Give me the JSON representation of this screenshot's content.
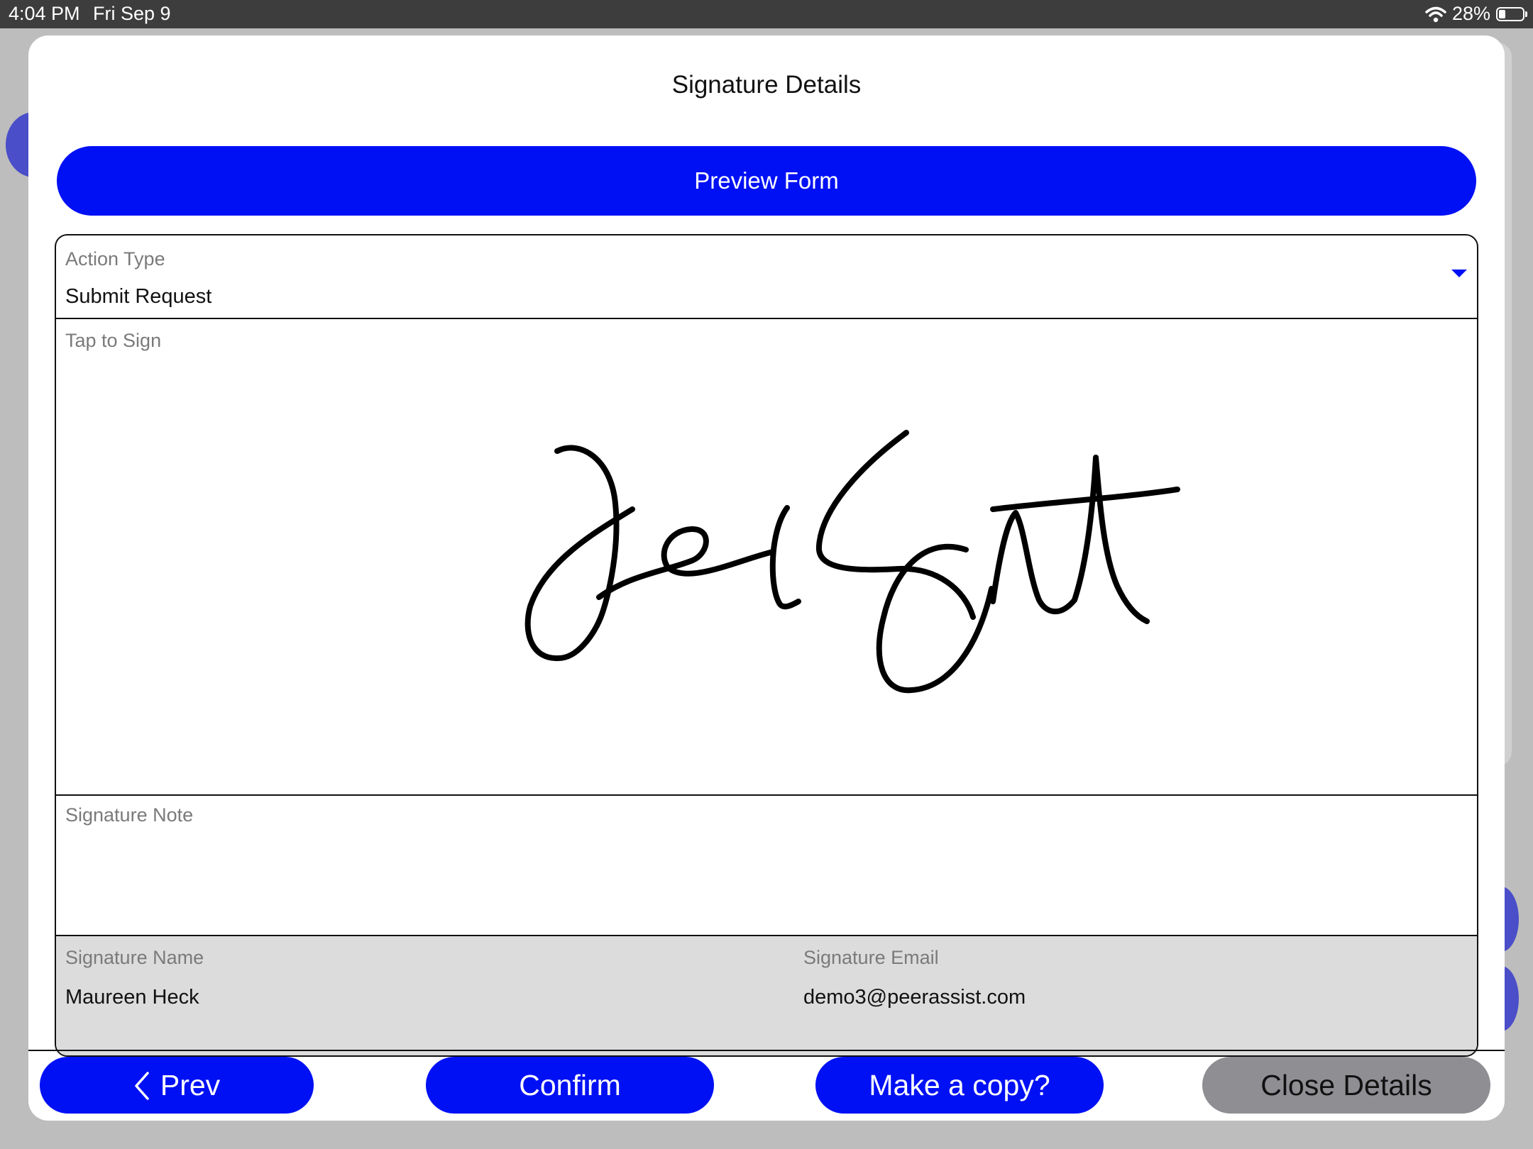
{
  "status_bar": {
    "time": "4:04 PM",
    "date": "Fri Sep 9",
    "battery_text": "28%",
    "battery_level": 0.28
  },
  "sheet": {
    "title": "Signature Details",
    "preview_button_label": "Preview Form"
  },
  "form": {
    "action_type": {
      "label": "Action Type",
      "value": "Submit Request"
    },
    "signature": {
      "label": "Tap to Sign"
    },
    "note": {
      "label": "Signature Note",
      "value": ""
    },
    "signature_name": {
      "label": "Signature Name",
      "value": "Maureen Heck"
    },
    "signature_email": {
      "label": "Signature Email",
      "value": "demo3@peerassist.com"
    }
  },
  "footer": {
    "prev_label": "Prev",
    "confirm_label": "Confirm",
    "copy_label": "Make a copy?",
    "close_label": "Close Details"
  },
  "colors": {
    "accent_blue": "#0010f5",
    "close_gray": "#8e8e93",
    "readonly_bg": "#dcdcdc"
  }
}
